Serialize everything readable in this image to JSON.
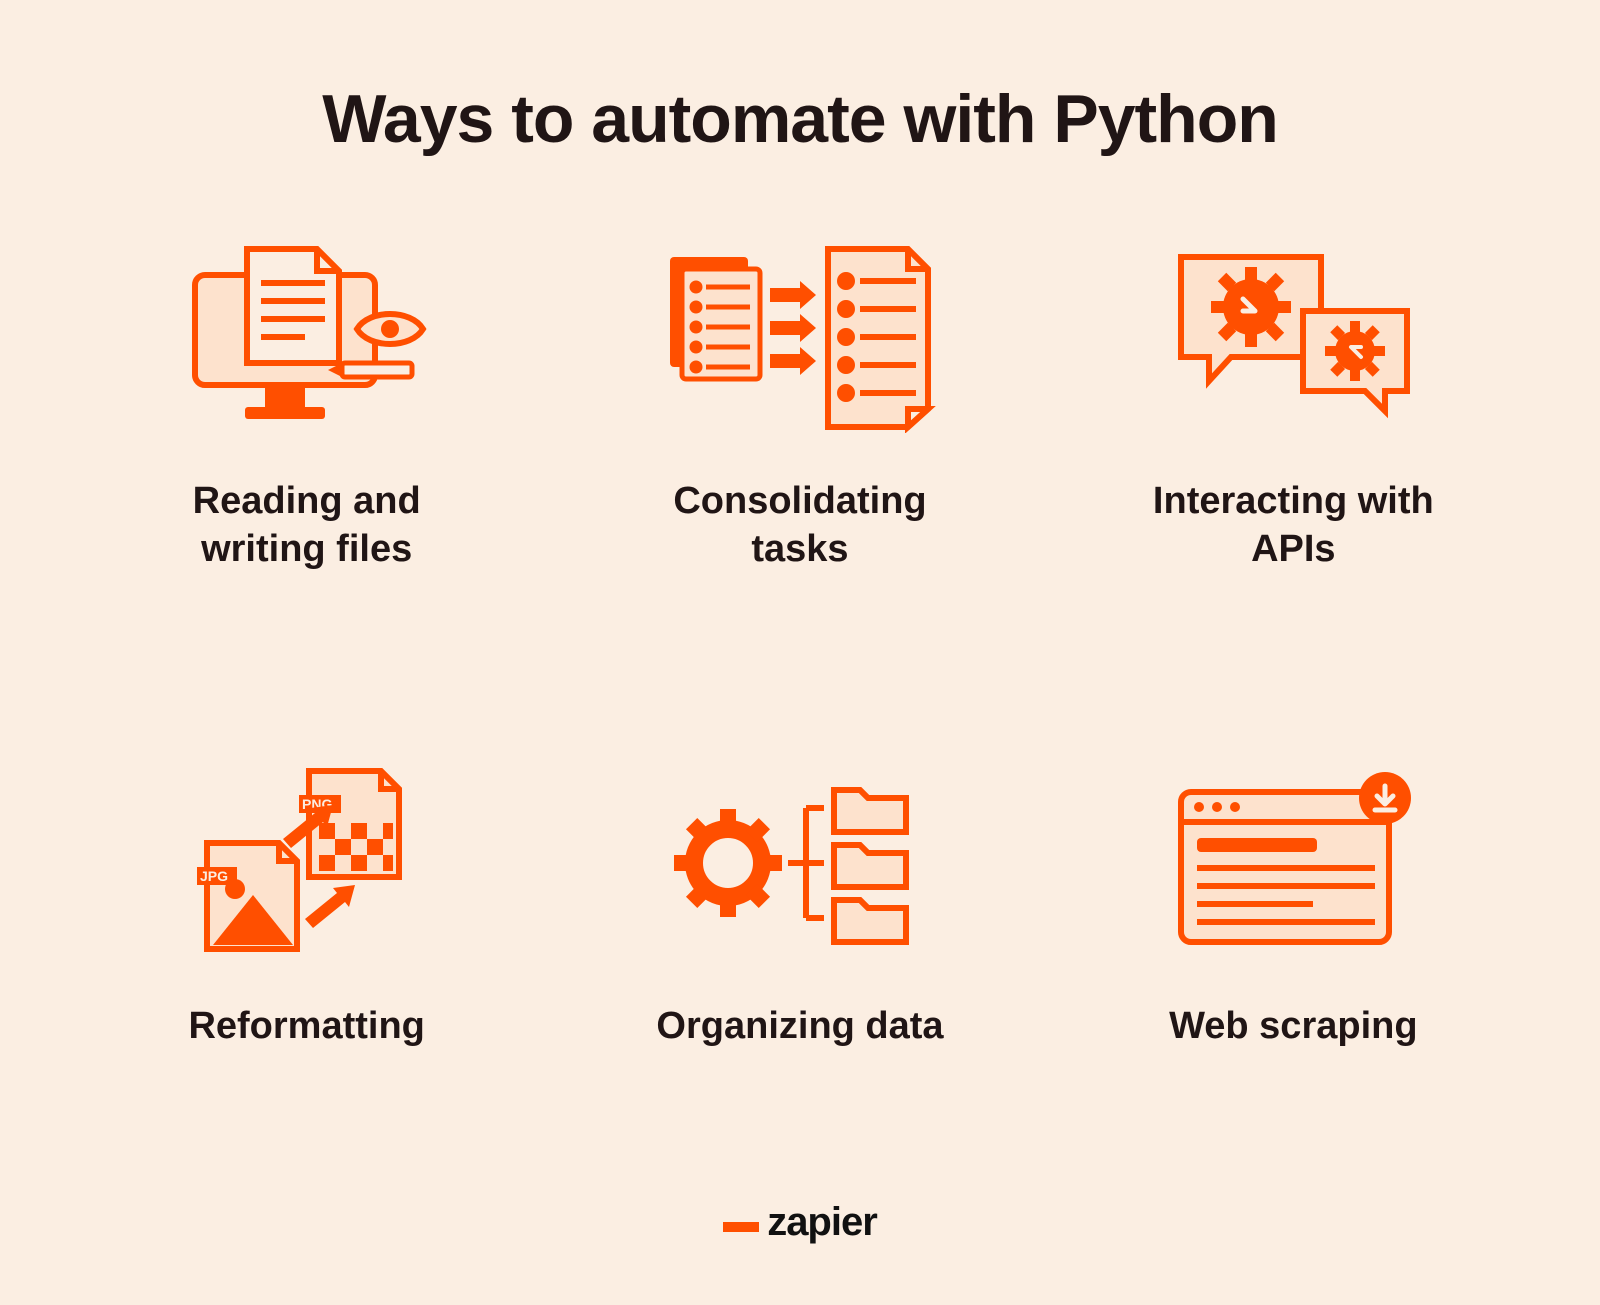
{
  "title": "Ways to automate with Python",
  "items": [
    {
      "label": "Reading and writing files",
      "icon": "reading-writing-files-icon"
    },
    {
      "label": "Consolidating tasks",
      "icon": "consolidating-tasks-icon"
    },
    {
      "label": "Interacting with APIs",
      "icon": "interacting-apis-icon"
    },
    {
      "label": "Reformatting",
      "icon": "reformatting-icon"
    },
    {
      "label": "Organizing data",
      "icon": "organizing-data-icon"
    },
    {
      "label": "Web scraping",
      "icon": "web-scraping-icon"
    }
  ],
  "logo": {
    "underscore_color": "#FF4F00",
    "text": "zapier"
  },
  "colors": {
    "bg": "#FBEEE2",
    "stroke": "#FF4F00",
    "accent_fill": "#FF4F00",
    "light_fill": "#FDE2CD",
    "text": "#201515"
  },
  "icon_labels": {
    "jpg": "JPG",
    "png": "PNG"
  }
}
